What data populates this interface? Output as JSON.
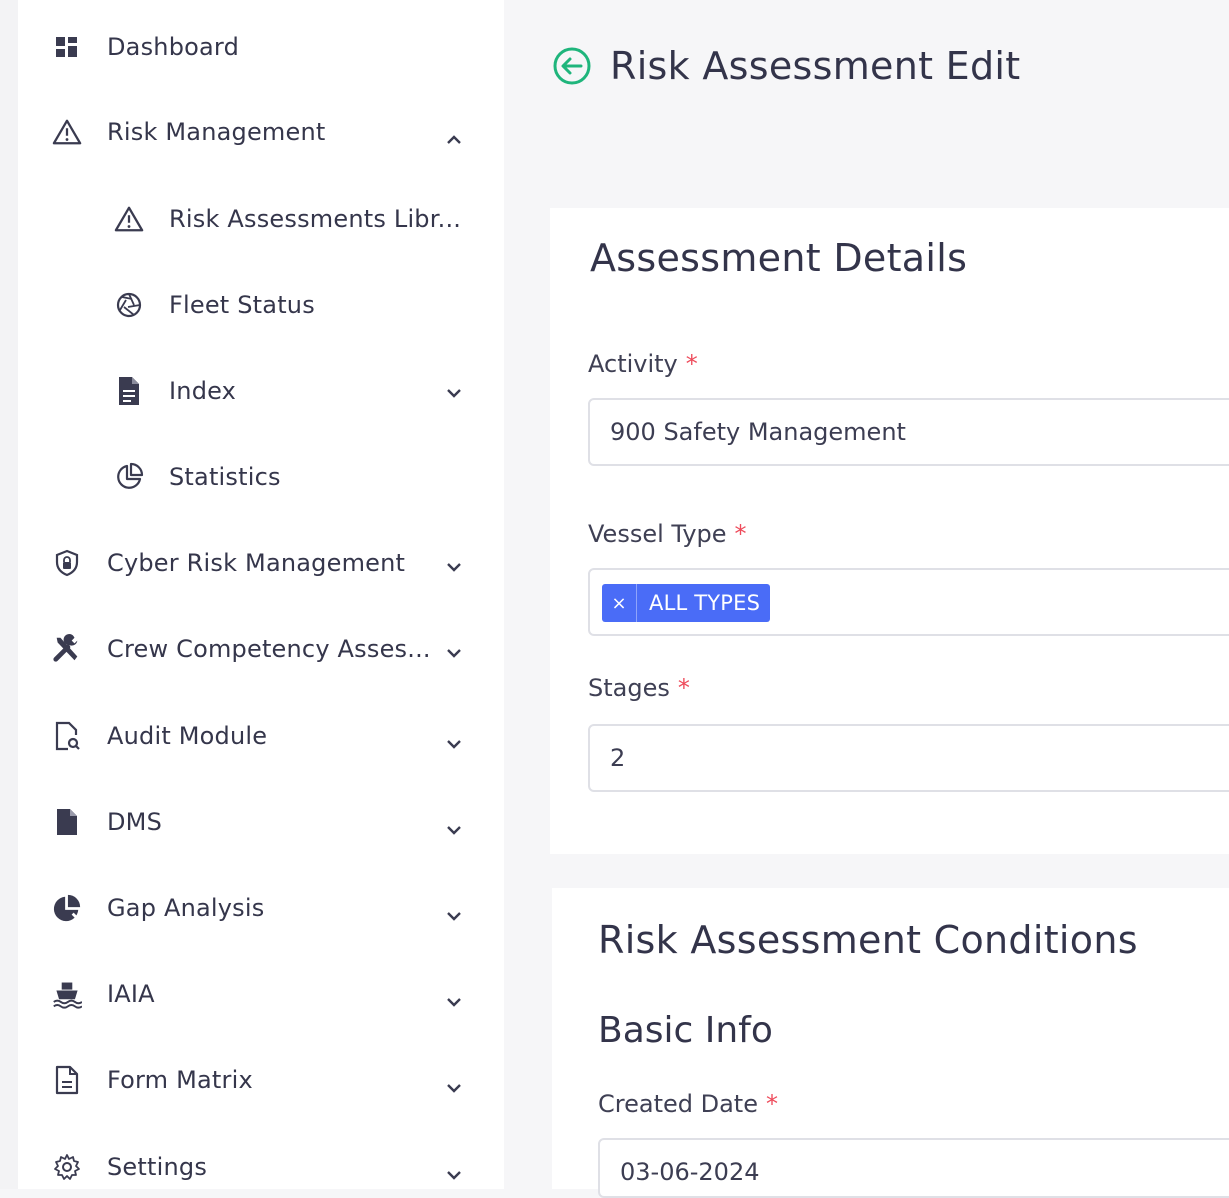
{
  "sidebar": {
    "items": [
      {
        "label": "Dashboard",
        "icon": "dashboard-grid-icon"
      },
      {
        "label": "Risk Management",
        "icon": "warning-triangle-icon",
        "chevron": "up"
      },
      {
        "label": "Risk Assessments Libr...",
        "icon": "warning-triangle-icon"
      },
      {
        "label": "Fleet Status",
        "icon": "aperture-icon"
      },
      {
        "label": "Index",
        "icon": "document-icon",
        "chevron": "down"
      },
      {
        "label": "Statistics",
        "icon": "pie-chart-outline-icon"
      },
      {
        "label": "Cyber Risk Management",
        "icon": "shield-lock-icon",
        "chevron": "down"
      },
      {
        "label": "Crew Competency Asses...",
        "icon": "tools-icon",
        "chevron": "down"
      },
      {
        "label": "Audit Module",
        "icon": "file-search-icon",
        "chevron": "down"
      },
      {
        "label": "DMS",
        "icon": "file-filled-icon",
        "chevron": "down"
      },
      {
        "label": "Gap Analysis",
        "icon": "pie-chart-icon",
        "chevron": "down"
      },
      {
        "label": "IAIA",
        "icon": "ship-icon",
        "chevron": "down"
      },
      {
        "label": "Form Matrix",
        "icon": "form-document-icon",
        "chevron": "down"
      },
      {
        "label": "Settings",
        "icon": "gear-icon",
        "chevron": "down"
      }
    ]
  },
  "header": {
    "title": "Risk Assessment Edit",
    "back_icon": "back-arrow-circle-icon"
  },
  "assessment_details": {
    "title": "Assessment Details",
    "activity_label": "Activity",
    "activity_value": "900 Safety Management",
    "vessel_type_label": "Vessel Type",
    "vessel_type_tag": "ALL TYPES",
    "vessel_type_remove": "×",
    "stages_label": "Stages",
    "stages_value": "2",
    "required_mark": "*"
  },
  "conditions": {
    "title": "Risk Assessment Conditions",
    "basic_info_title": "Basic Info",
    "created_date_label": "Created Date",
    "created_date_value": "03-06-2024"
  },
  "colors": {
    "accent": "#4a6cf7",
    "back_icon": "#1fb57c",
    "required": "#ee4b5b"
  }
}
